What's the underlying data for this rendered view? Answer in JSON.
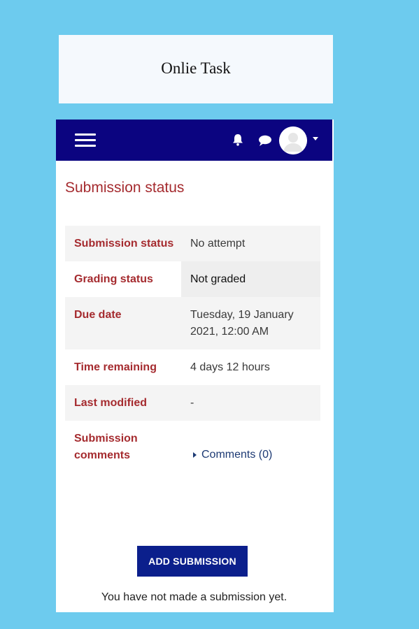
{
  "page_title": "Onlie Task",
  "navbar": {
    "menu_icon": "hamburger-menu-icon",
    "notification_icon": "bell-icon",
    "messages_icon": "chat-bubble-icon",
    "user_icon": "user-avatar",
    "user_menu_icon": "caret-down-icon",
    "bar_color": "#0b0480"
  },
  "heading": "Submission status",
  "status_rows": [
    {
      "label": "Submission status",
      "value": "No attempt"
    },
    {
      "label": "Grading status",
      "value": "Not graded"
    },
    {
      "label": "Due date",
      "value": "Tuesday, 19 January 2021, 12:00 AM"
    },
    {
      "label": "Time remaining",
      "value": "4 days 12 hours"
    },
    {
      "label": "Last modified",
      "value": "-"
    },
    {
      "label": "Submission comments",
      "value": "Comments (0)"
    }
  ],
  "add_submission_label": "ADD SUBMISSION",
  "note": "You have not made a submission yet.",
  "colors": {
    "background": "#6dcbee",
    "label_text": "#a52b2f",
    "button": "#0b1f8c"
  }
}
